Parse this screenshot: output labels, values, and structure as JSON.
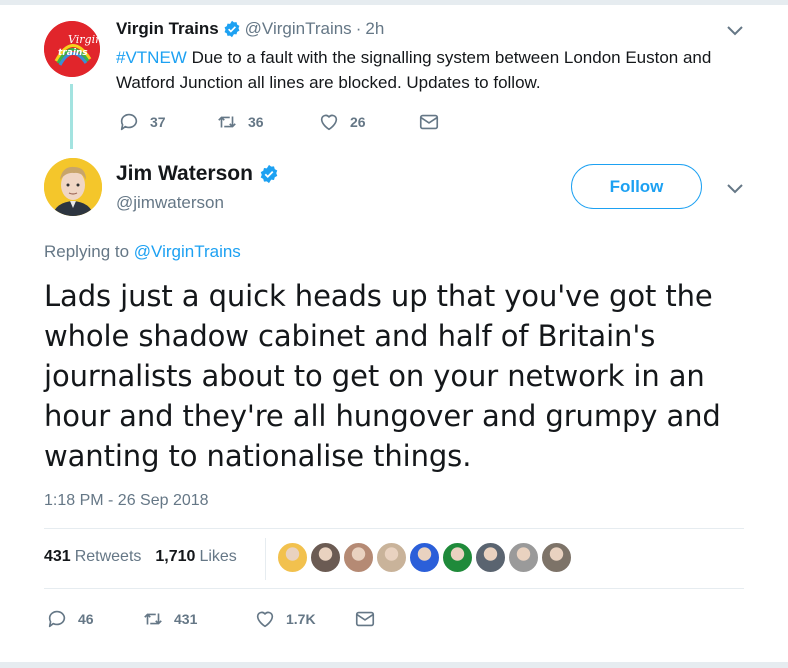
{
  "parent_tweet": {
    "name": "Virgin Trains",
    "handle": "@VirginTrains",
    "separator": "·",
    "time": "2h",
    "hashtag": "#VTNEW",
    "text": " Due to a fault with the signalling system between London Euston and Watford Junction all lines are blocked. Updates to follow.",
    "avatar_text": "trains",
    "replies": "37",
    "retweets": "36",
    "likes": "26"
  },
  "main_tweet": {
    "name": "Jim Waterson",
    "handle": "@jimwaterson",
    "follow_label": "Follow",
    "replying_prefix": "Replying to ",
    "replying_to": "@VirginTrains",
    "text": "Lads just a quick heads up that you've got the whole shadow cabinet and half of Britain's journalists about to get on your network in an hour and they're all hungover and grumpy and wanting to nationalise things.",
    "timestamp": "1:18 PM - 26 Sep 2018",
    "retweets_count": "431",
    "retweets_label": "Retweets",
    "likes_count": "1,710",
    "likes_label": "Likes",
    "replies": "46",
    "retweets": "431",
    "likes": "1.7K"
  },
  "liker_avatars": [
    {
      "name": "avatar-1",
      "color": "#f2c14e"
    },
    {
      "name": "avatar-2",
      "color": "#6b5b53"
    },
    {
      "name": "avatar-3",
      "color": "#b58a74"
    },
    {
      "name": "avatar-4",
      "color": "#c9b39a"
    },
    {
      "name": "avatar-5",
      "color": "#2b5fd9"
    },
    {
      "name": "avatar-6",
      "color": "#1f8a3a"
    },
    {
      "name": "avatar-7",
      "color": "#5a6470"
    },
    {
      "name": "avatar-8",
      "color": "#9a9a9a"
    },
    {
      "name": "avatar-9",
      "color": "#7d7368"
    }
  ],
  "colors": {
    "accent": "#1da1f2",
    "text": "#14171a",
    "muted": "#657786",
    "virgin_red": "#e1252b",
    "thread_line": "#a3e3e0"
  }
}
